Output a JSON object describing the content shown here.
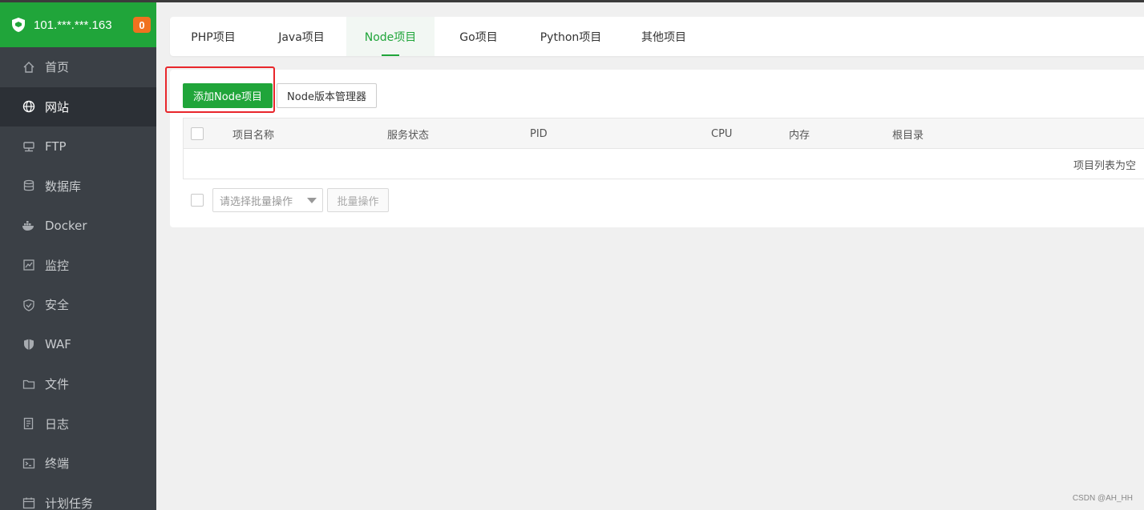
{
  "server": {
    "ip": "101.***.***.163",
    "badge": "0"
  },
  "sidebar": {
    "items": [
      {
        "label": "首页",
        "icon": "home-icon"
      },
      {
        "label": "网站",
        "icon": "globe-icon"
      },
      {
        "label": "FTP",
        "icon": "ftp-icon"
      },
      {
        "label": "数据库",
        "icon": "database-icon"
      },
      {
        "label": "Docker",
        "icon": "docker-icon"
      },
      {
        "label": "监控",
        "icon": "monitor-icon"
      },
      {
        "label": "安全",
        "icon": "shield-check-icon"
      },
      {
        "label": "WAF",
        "icon": "waf-shield-icon"
      },
      {
        "label": "文件",
        "icon": "folder-icon"
      },
      {
        "label": "日志",
        "icon": "log-icon"
      },
      {
        "label": "终端",
        "icon": "terminal-icon"
      },
      {
        "label": "计划任务",
        "icon": "calendar-icon"
      }
    ],
    "active_index": 1
  },
  "tabs": [
    {
      "label": "PHP项目"
    },
    {
      "label": "Java项目"
    },
    {
      "label": "Node项目"
    },
    {
      "label": "Go项目"
    },
    {
      "label": "Python项目"
    },
    {
      "label": "其他项目"
    }
  ],
  "active_tab": 2,
  "toolbar": {
    "add_label": "添加Node项目",
    "manager_label": "Node版本管理器"
  },
  "table": {
    "columns": [
      "项目名称",
      "服务状态",
      "PID",
      "CPU",
      "内存",
      "根目录"
    ],
    "empty_text": "项目列表为空"
  },
  "bulk": {
    "select_placeholder": "请选择批量操作",
    "button_label": "批量操作"
  },
  "watermark": "CSDN @AH_HH",
  "colors": {
    "accent": "#20a53a",
    "sidebar_bg": "#3b4046",
    "badge": "#f0721f",
    "highlight_box": "#e8262b"
  }
}
